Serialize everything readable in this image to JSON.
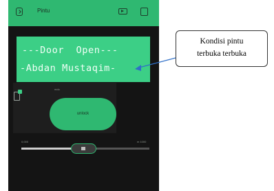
{
  "app": {
    "title": "Pintu"
  },
  "topbar": {
    "back_icon": "back-icon",
    "play_icon": "play-icon",
    "square_icon": "square-icon",
    "color": "#2fb871"
  },
  "lcd": {
    "line1": "---Door  Open---",
    "line2": "-Abdan Mustaqim-",
    "background": "#3ccf86"
  },
  "widget": {
    "icon": "phone-icon",
    "label": "mdu",
    "button_label": "unlock"
  },
  "slider": {
    "min_label": "0,000",
    "max_label": "m 1000",
    "value_fraction": 0.45
  },
  "annotation": {
    "line1": "Kondisi pintu",
    "line2": "terbuka terbuka",
    "arrow_color": "#2f6fc7"
  }
}
